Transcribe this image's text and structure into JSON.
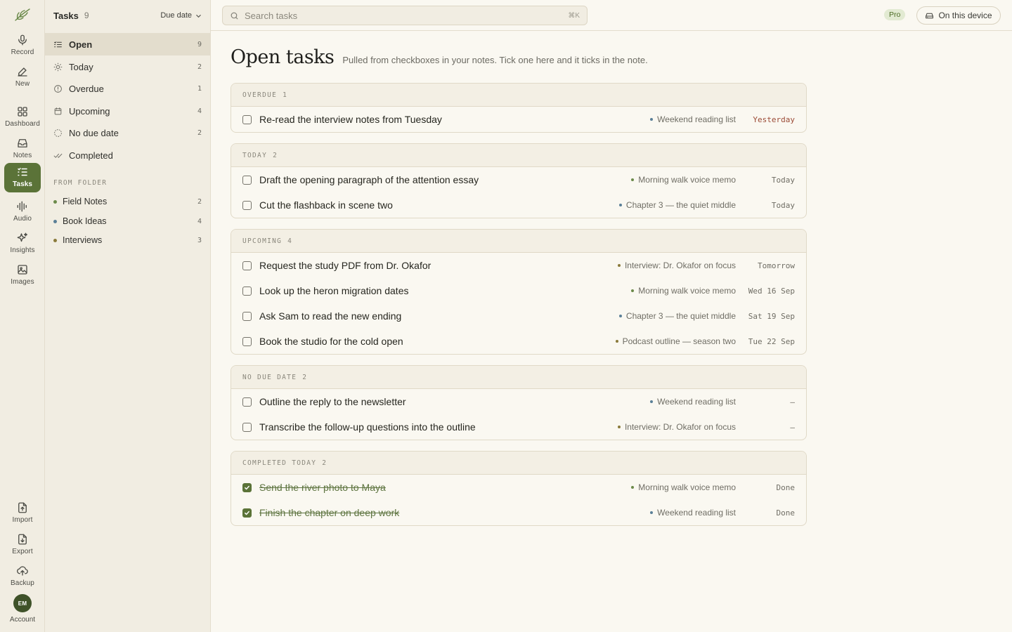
{
  "rail": {
    "top": [
      {
        "label": "Record",
        "icon": "mic-icon"
      },
      {
        "label": "New",
        "icon": "pen-icon"
      },
      {
        "label": "Dashboard",
        "icon": "grid-icon"
      },
      {
        "label": "Notes",
        "icon": "inbox-icon"
      },
      {
        "label": "Tasks",
        "icon": "checklist-icon",
        "active": true
      },
      {
        "label": "Audio",
        "icon": "waveform-icon"
      },
      {
        "label": "Insights",
        "icon": "sparkle-icon"
      },
      {
        "label": "Images",
        "icon": "image-icon"
      }
    ],
    "bottom": [
      {
        "label": "Import",
        "icon": "import-icon"
      },
      {
        "label": "Export",
        "icon": "export-icon"
      },
      {
        "label": "Backup",
        "icon": "cloud-upload-icon"
      }
    ],
    "account": {
      "initials": "EM",
      "label": "Account"
    }
  },
  "sidebar": {
    "title": "Tasks",
    "count": "9",
    "sort_label": "Due date",
    "filters": [
      {
        "label": "Open",
        "count": "9",
        "icon": "checklist-icon",
        "active": true
      },
      {
        "label": "Today",
        "count": "2",
        "icon": "sun-icon"
      },
      {
        "label": "Overdue",
        "count": "1",
        "icon": "alert-circle-icon"
      },
      {
        "label": "Upcoming",
        "count": "4",
        "icon": "calendar-icon"
      },
      {
        "label": "No due date",
        "count": "2",
        "icon": "dashed-circle-icon"
      },
      {
        "label": "Completed",
        "count": "",
        "icon": "double-check-icon"
      }
    ],
    "section_label": "FROM FOLDER",
    "folders": [
      {
        "label": "Field Notes",
        "count": "2",
        "color": "#6b8a4a"
      },
      {
        "label": "Book Ideas",
        "count": "4",
        "color": "#5a7f97"
      },
      {
        "label": "Interviews",
        "count": "3",
        "color": "#8a7a3a"
      }
    ]
  },
  "search": {
    "placeholder": "Search tasks",
    "shortcut": "⌘K"
  },
  "topbar": {
    "pro_label": "Pro",
    "device_label": "On this device"
  },
  "main": {
    "title": "Open tasks",
    "subtitle": "Pulled from checkboxes in your notes. Tick one here and it ticks in the note.",
    "groups": [
      {
        "label": "OVERDUE",
        "count": "1",
        "tasks": [
          {
            "text": "Re-read the interview notes from Tuesday",
            "source": "Weekend reading list",
            "source_color": "#5a7f97",
            "due": "Yesterday",
            "overdue": true
          }
        ]
      },
      {
        "label": "TODAY",
        "count": "2",
        "tasks": [
          {
            "text": "Draft the opening paragraph of the attention essay",
            "source": "Morning walk voice memo",
            "source_color": "#6b8a4a",
            "due": "Today"
          },
          {
            "text": "Cut the flashback in scene two",
            "source": "Chapter 3 — the quiet middle",
            "source_color": "#5a7f97",
            "due": "Today"
          }
        ]
      },
      {
        "label": "UPCOMING",
        "count": "4",
        "tasks": [
          {
            "text": "Request the study PDF from Dr. Okafor",
            "source": "Interview: Dr. Okafor on focus",
            "source_color": "#8a7a3a",
            "due": "Tomorrow"
          },
          {
            "text": "Look up the heron migration dates",
            "source": "Morning walk voice memo",
            "source_color": "#6b8a4a",
            "due": "Wed 16 Sep"
          },
          {
            "text": "Ask Sam to read the new ending",
            "source": "Chapter 3 — the quiet middle",
            "source_color": "#5a7f97",
            "due": "Sat 19 Sep"
          },
          {
            "text": "Book the studio for the cold open",
            "source": "Podcast outline — season two",
            "source_color": "#8a7a3a",
            "due": "Tue 22 Sep"
          }
        ]
      },
      {
        "label": "NO DUE DATE",
        "count": "2",
        "tasks": [
          {
            "text": "Outline the reply to the newsletter",
            "source": "Weekend reading list",
            "source_color": "#5a7f97",
            "due": "–"
          },
          {
            "text": "Transcribe the follow-up questions into the outline",
            "source": "Interview: Dr. Okafor on focus",
            "source_color": "#8a7a3a",
            "due": "–"
          }
        ]
      },
      {
        "label": "COMPLETED TODAY",
        "count": "2",
        "completed": true,
        "tasks": [
          {
            "text": "Send the river photo to Maya",
            "source": "Morning walk voice memo",
            "source_color": "#6b8a4a",
            "due": "Done",
            "done": true
          },
          {
            "text": "Finish the chapter on deep work",
            "source": "Weekend reading list",
            "source_color": "#5a7f97",
            "due": "Done",
            "done": true
          }
        ]
      }
    ]
  }
}
